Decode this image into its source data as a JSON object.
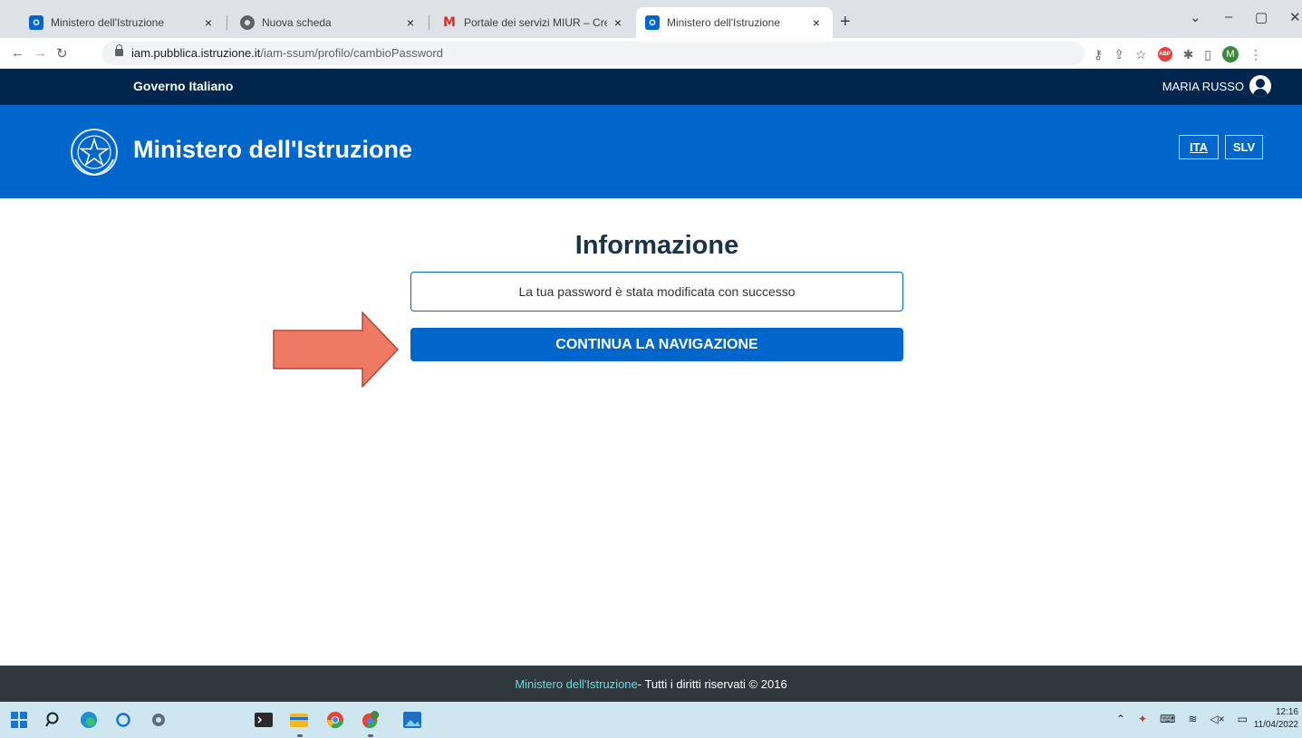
{
  "browser": {
    "tabs": [
      {
        "title": "Ministero dell'Istruzione",
        "active": false
      },
      {
        "title": "Nuova scheda",
        "active": false
      },
      {
        "title": "Portale dei servizi MIUR – Creazio",
        "active": false
      },
      {
        "title": "Ministero dell'Istruzione",
        "active": true
      }
    ],
    "new_tab": "+",
    "close_glyph": "×",
    "url_host": "iam.pubblica.istruzione.it",
    "url_path": "/iam-ssum/profilo/cambioPassword",
    "profile_initial": "M",
    "abp_label": "ABP"
  },
  "header": {
    "gov_title": "Governo Italiano",
    "user_name": "MARIA RUSSO",
    "ministry_title": "Ministero dell'Istruzione",
    "languages": [
      "ITA",
      "SLV"
    ],
    "active_language": "ITA"
  },
  "main": {
    "title": "Informazione",
    "message": "La tua password è stata modificata con successo",
    "continue_label": "CONTINUA LA NAVIGAZIONE",
    "arrow_color": "#ef7a64"
  },
  "footer": {
    "link": "Ministero dell'Istruzione",
    "rest": " - Tutti i diritti riservati © 2016"
  },
  "taskbar": {
    "time": "12:16",
    "date": "11/04/2022"
  },
  "colors": {
    "gov_bar": "#00264d",
    "brand": "#0066cc",
    "footer": "#30373d",
    "footer_link": "#65dcdf"
  }
}
